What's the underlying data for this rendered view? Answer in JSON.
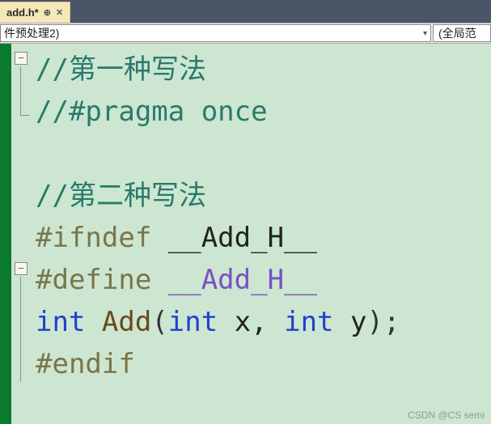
{
  "tab": {
    "title": "add.h*",
    "pin_glyph": "⊕",
    "close_glyph": "✕"
  },
  "toolbar": {
    "dropdown_text": "件预处理2)",
    "dropdown_arrow": "▾",
    "scope_text": "(全局范"
  },
  "code": {
    "line1_comment": "//第一种写法",
    "line2_comment": "//#pragma once",
    "line3_blank": "",
    "line4_comment": "//第二种写法",
    "line5_pp": "#ifndef",
    "line5_macro": " __Add_H__",
    "line6_pp": "#define ",
    "line6_macro": "__Add_H__",
    "line7_type1": "int",
    "line7_func": " Add",
    "line7_open": "(",
    "line7_type2": "int",
    "line7_arg1": " x, ",
    "line7_type3": "int",
    "line7_arg2": " y",
    "line7_close": ")",
    "line7_semi": ";",
    "line8_pp": "#endif"
  },
  "fold": {
    "minus": "−"
  },
  "watermark": "CSDN @CS semi"
}
